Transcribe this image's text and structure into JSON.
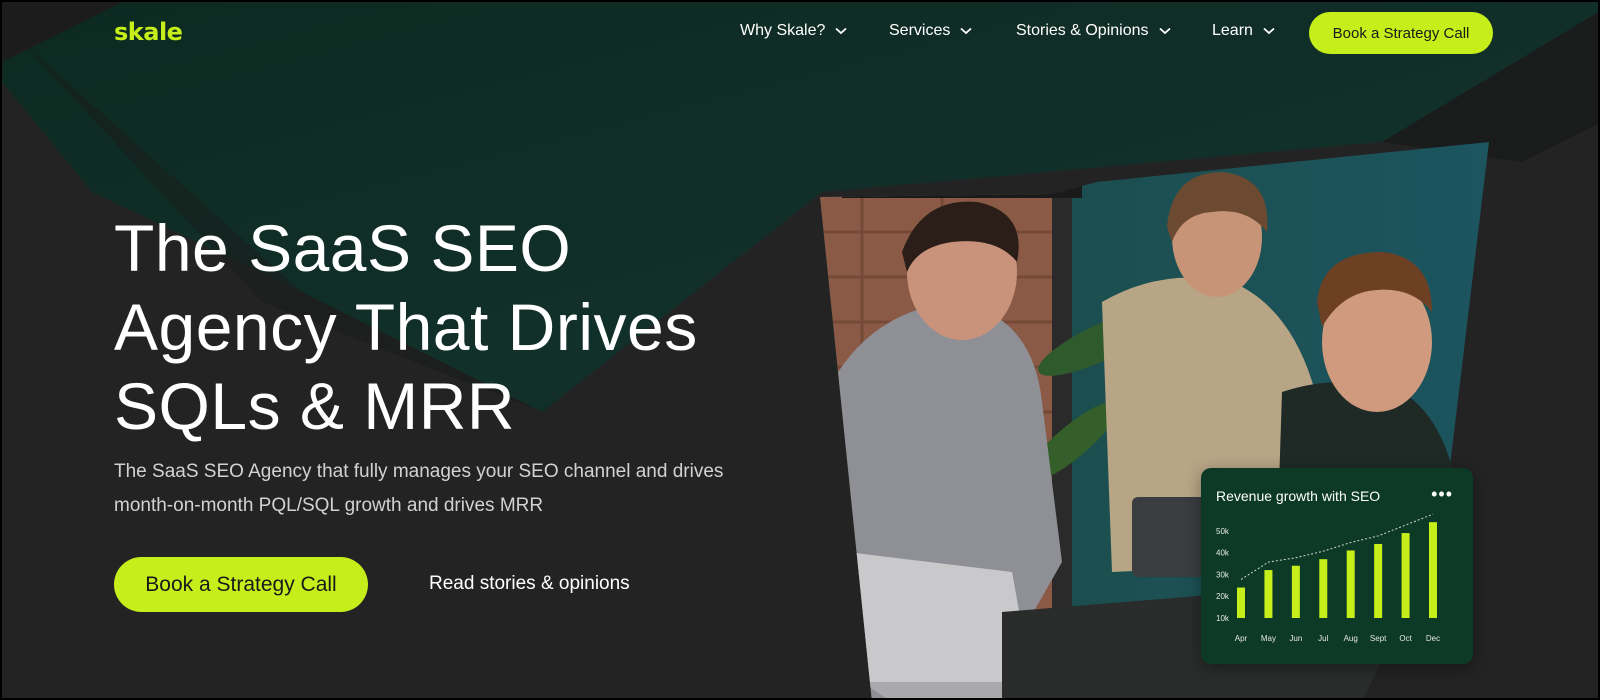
{
  "colors": {
    "accent": "#c6ee1a",
    "background": "#232323",
    "green_dark": "#0f2a21",
    "card": "#0c3a27"
  },
  "nav": {
    "logo": "skale",
    "items": [
      {
        "label": "Why Skale?"
      },
      {
        "label": "Services"
      },
      {
        "label": "Stories & Opinions"
      },
      {
        "label": "Learn"
      }
    ],
    "cta": "Book a Strategy Call"
  },
  "hero": {
    "title_lines": [
      "The SaaS SEO",
      "Agency That Drives",
      "SQLs & MRR"
    ],
    "subtitle_lines": [
      "The SaaS SEO Agency that fully manages your SEO channel and drives",
      "month-on-month PQL/SQL growth and drives MRR"
    ],
    "cta": "Book a Strategy Call",
    "link": "Read stories & opinions"
  },
  "card": {
    "title": "Revenue growth with SEO",
    "menu_icon": "more-dots-icon"
  },
  "chart_data": {
    "type": "bar",
    "title": "Revenue growth with SEO",
    "categories": [
      "Apr",
      "May",
      "Jun",
      "Jul",
      "Aug",
      "Sept",
      "Oct",
      "Dec"
    ],
    "values": [
      24,
      32,
      34,
      37,
      41,
      44,
      49,
      54
    ],
    "yticks": [
      "50k",
      "40k",
      "30k",
      "20k",
      "10k"
    ],
    "ytick_values": [
      50,
      40,
      30,
      20,
      10
    ],
    "ylim": [
      10,
      55
    ],
    "trendline": true,
    "grid": false
  }
}
